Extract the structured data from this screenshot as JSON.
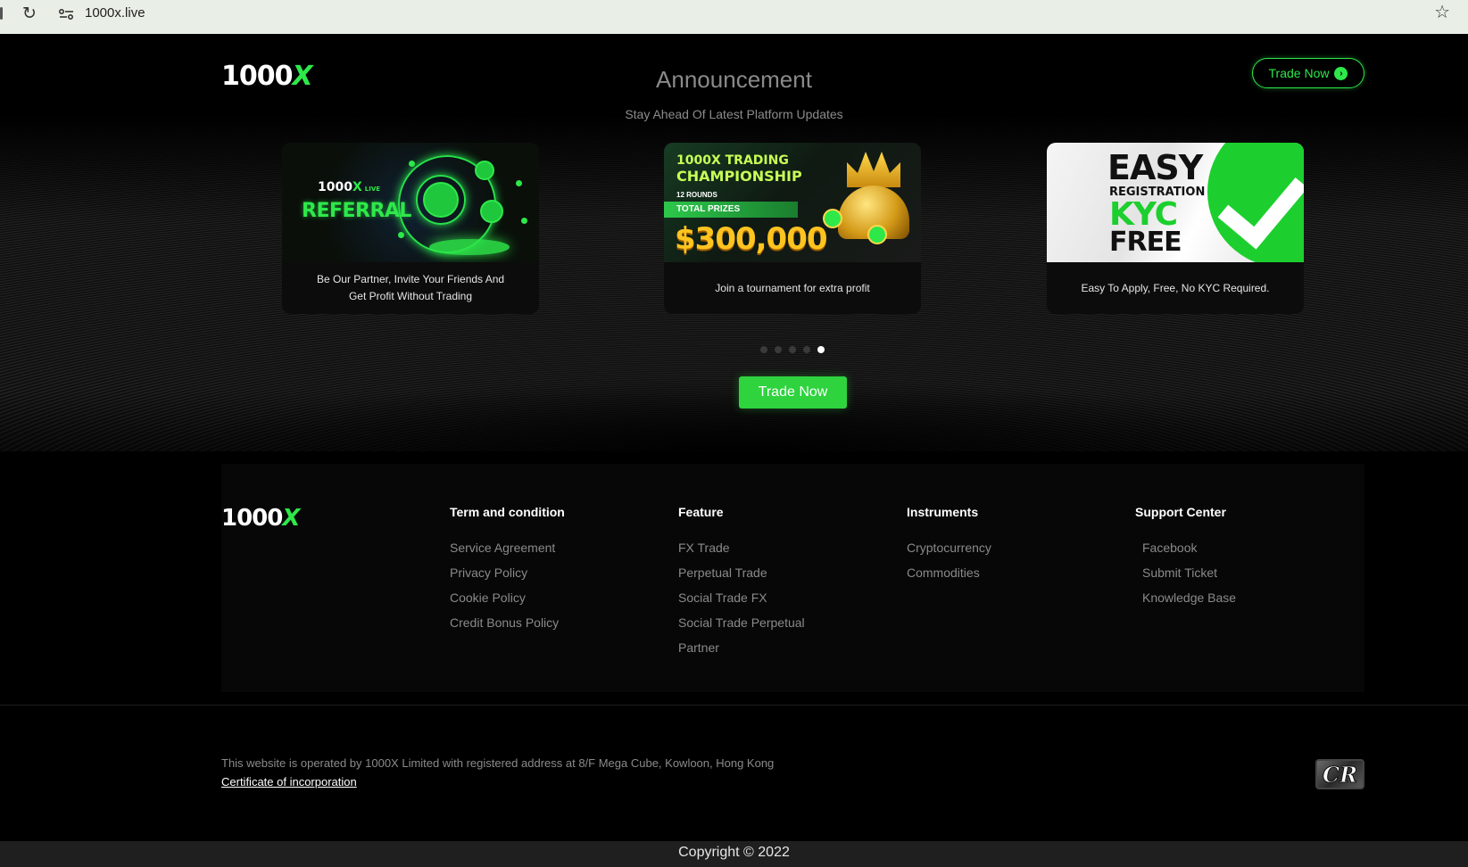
{
  "browser": {
    "url": "1000x.live"
  },
  "header": {
    "logo_num": "1000",
    "logo_x": "X",
    "title": "Announcement",
    "subtitle": "Stay Ahead Of Latest Platform Updates",
    "trade_now": "Trade Now"
  },
  "cards": [
    {
      "banner_logo_num": "1000",
      "banner_logo_x": "X",
      "banner_live": "LIVE",
      "banner_title": "REFERRAL",
      "caption": "Be Our Partner, Invite Your Friends And Get Profit Without Trading"
    },
    {
      "line1": "1000X TRADING",
      "line2": "CHAMPIONSHIP",
      "rounds": "12 ROUNDS",
      "prizes": "TOTAL PRIZES",
      "amount": "$300,000",
      "caption": "Join a tournament  for extra profit"
    },
    {
      "e1": "EASY",
      "e2": "REGISTRATION",
      "e3": "KYC",
      "e4": "FREE",
      "caption": "Easy To Apply, Free, No KYC Required."
    }
  ],
  "carousel": {
    "total": 5,
    "active": 5
  },
  "cta": {
    "trade_now": "Trade Now"
  },
  "footer": {
    "logo_num": "1000",
    "logo_x": "X",
    "columns": [
      {
        "title": "Term and condition",
        "links": [
          "Service Agreement",
          "Privacy Policy",
          "Cookie Policy",
          "Credit Bonus Policy"
        ]
      },
      {
        "title": "Feature",
        "links": [
          "FX Trade",
          "Perpetual Trade",
          "Social Trade FX",
          "Social Trade Perpetual",
          "Partner"
        ]
      },
      {
        "title": "Instruments",
        "links": [
          "Cryptocurrency",
          "Commodities"
        ]
      },
      {
        "title": "Support Center",
        "links": [
          "Facebook",
          "Submit Ticket",
          "Knowledge Base"
        ]
      }
    ],
    "legal": "This website is operated by 1000X Limited with registered address at 8/F Mega Cube, Kowloon, Hong Kong",
    "certificate": "Certificate of incorporation",
    "badge": "CR",
    "copyright": "Copyright © 2022"
  },
  "colors": {
    "accent": "#2ee84a",
    "background": "#000000",
    "muted_text": "#8a8a8a"
  }
}
